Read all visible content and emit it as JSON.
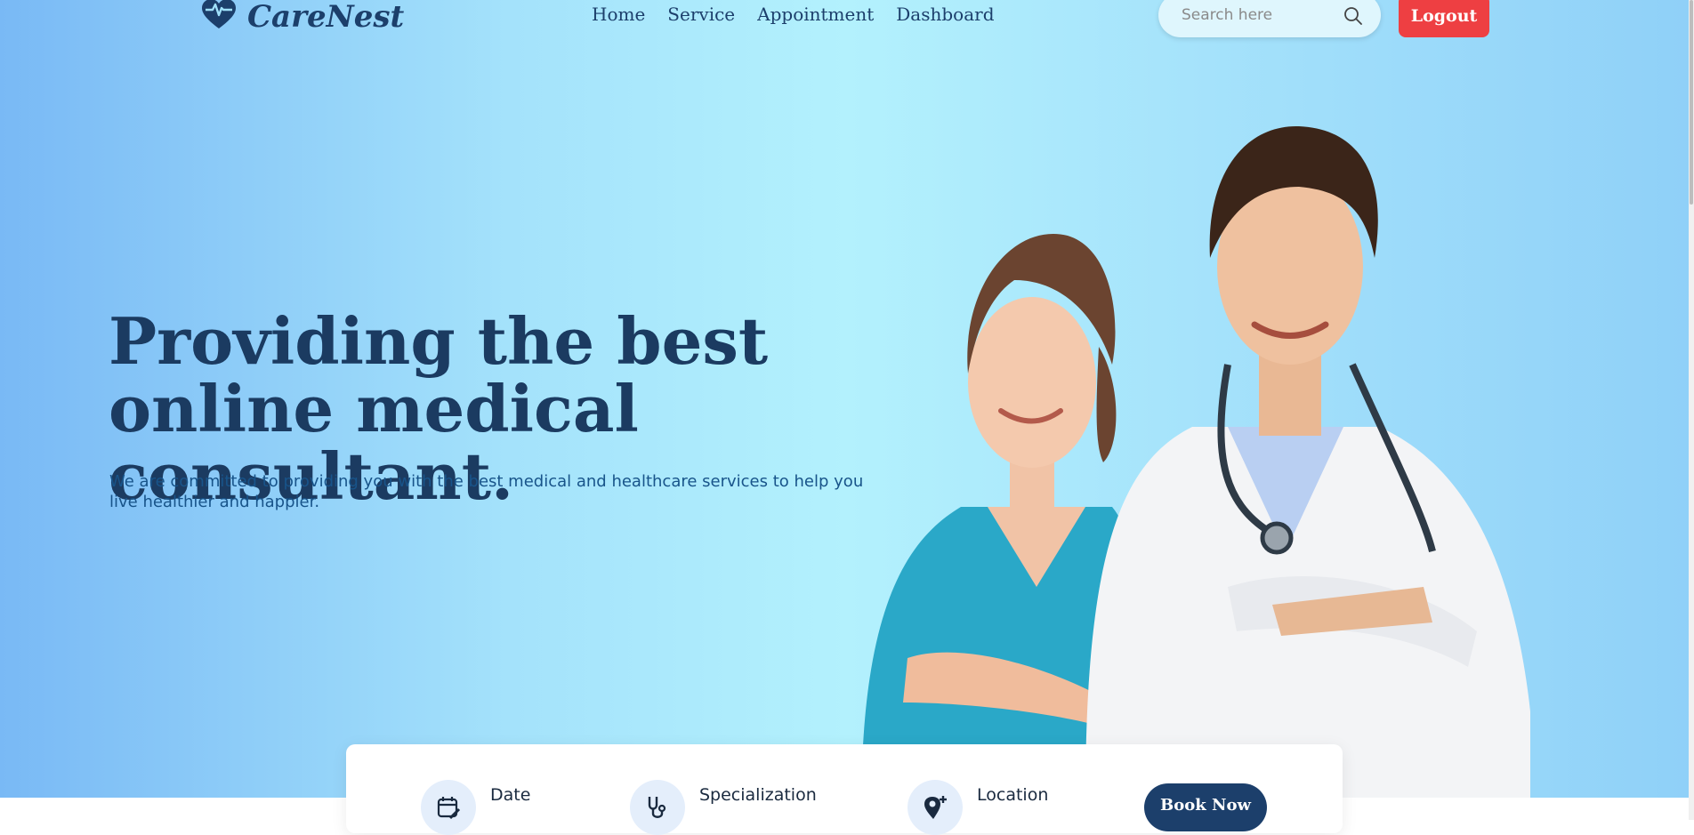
{
  "brand": {
    "name": "CareNest",
    "logo_icon": "heart-pulse-icon",
    "color": "#1c3f6b"
  },
  "nav": {
    "items": [
      "Home",
      "Service",
      "Appointment",
      "Dashboard"
    ]
  },
  "search": {
    "placeholder": "Search here",
    "icon": "search-icon"
  },
  "logout": {
    "label": "Logout",
    "color": "#ee3f42"
  },
  "hero": {
    "title": "Providing the best online medical consultant.",
    "subtitle": "We are committed to providing you with the best medical and healthcare services to help you live healthier and happier."
  },
  "booking": {
    "fields": [
      {
        "label": "Date",
        "icon": "calendar-edit-icon"
      },
      {
        "label": "Specialization",
        "icon": "stethoscope-icon"
      },
      {
        "label": "Location",
        "icon": "location-pin-plus-icon"
      }
    ],
    "button_label": "Book Now"
  }
}
